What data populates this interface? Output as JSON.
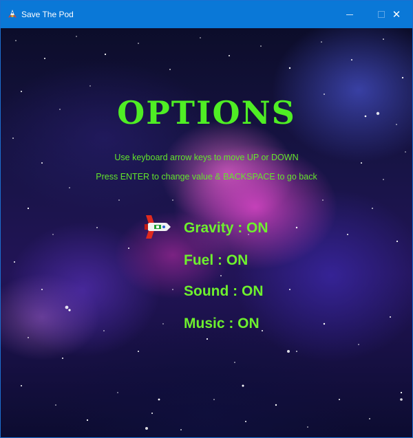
{
  "window": {
    "title": "Save The Pod",
    "minimize_icon": "minimize-icon",
    "maximize_icon": "maximize-icon",
    "close_icon": "close-icon",
    "close_glyph": "✕"
  },
  "screen": {
    "heading": "OPTIONS",
    "instructions": [
      "Use keyboard arrow keys to move UP or DOWN",
      "Press ENTER to change value & BACKSPACE to go back"
    ],
    "menu": [
      {
        "label": "Gravity : ON",
        "selected": true
      },
      {
        "label": "Fuel : ON",
        "selected": false
      },
      {
        "label": "Sound : ON",
        "selected": false
      },
      {
        "label": "Music : ON",
        "selected": false
      }
    ],
    "cursor_icon": "spaceship-icon"
  },
  "colors": {
    "titlebar": "#0a78d7",
    "heading": "#4fee24",
    "menu_text": "#6ef02e",
    "instruction_text": "#63e62b"
  }
}
